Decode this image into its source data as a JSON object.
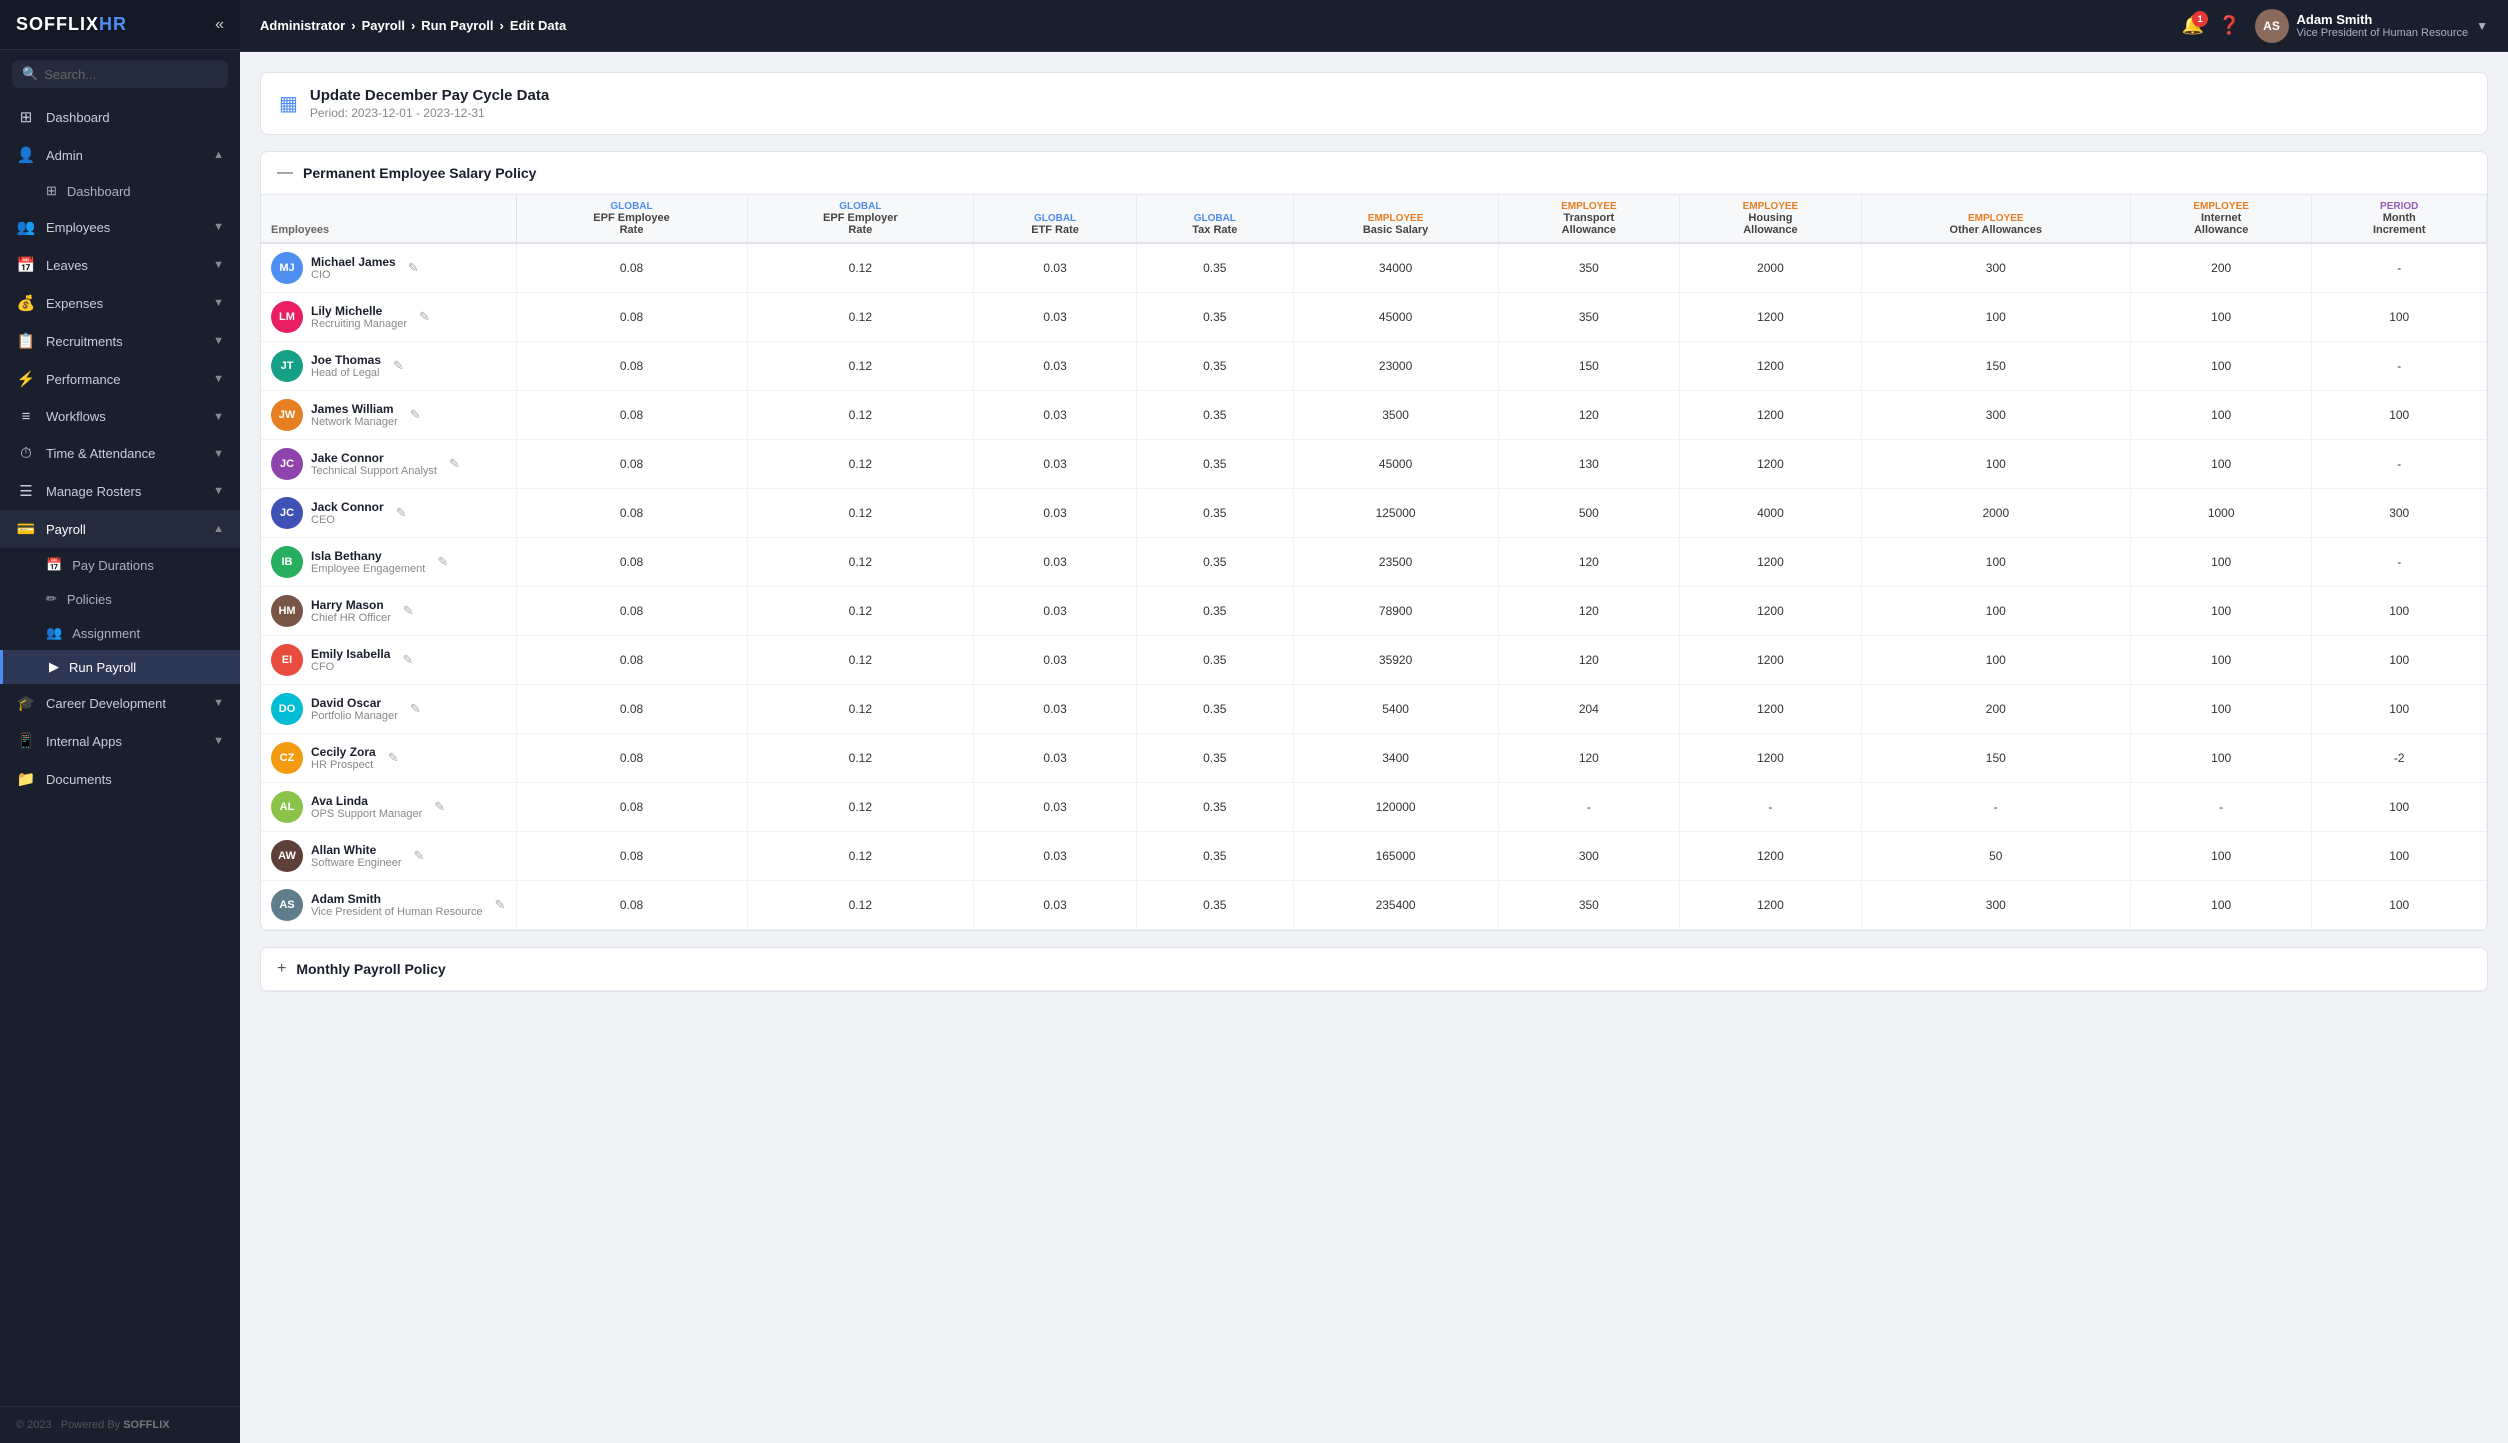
{
  "app": {
    "name": "SOFFLIX",
    "name_suffix": "HR",
    "logo_label": "SOFFLIXHR"
  },
  "sidebar": {
    "search_placeholder": "Search...",
    "items": [
      {
        "id": "dashboard",
        "label": "Dashboard",
        "icon": "⊞",
        "has_sub": false,
        "active": false
      },
      {
        "id": "admin",
        "label": "Admin",
        "icon": "👤",
        "has_sub": true,
        "active": false,
        "sub": [
          {
            "label": "Dashboard",
            "icon": "⊞"
          }
        ]
      },
      {
        "id": "employees",
        "label": "Employees",
        "icon": "👥",
        "has_sub": true,
        "active": false,
        "sub": []
      },
      {
        "id": "leaves",
        "label": "Leaves",
        "icon": "📅",
        "has_sub": true,
        "active": false,
        "sub": []
      },
      {
        "id": "expenses",
        "label": "Expenses",
        "icon": "💰",
        "has_sub": true,
        "active": false,
        "sub": []
      },
      {
        "id": "recruitments",
        "label": "Recruitments",
        "icon": "📋",
        "has_sub": true,
        "active": false,
        "sub": []
      },
      {
        "id": "performance",
        "label": "Performance",
        "icon": "⚡",
        "has_sub": true,
        "active": false,
        "sub": []
      },
      {
        "id": "workflows",
        "label": "Workflows",
        "icon": "≡",
        "has_sub": true,
        "active": false,
        "sub": []
      },
      {
        "id": "time-attendance",
        "label": "Time & Attendance",
        "icon": "⏱",
        "has_sub": true,
        "active": false,
        "sub": []
      },
      {
        "id": "manage-rosters",
        "label": "Manage Rosters",
        "icon": "☰",
        "has_sub": true,
        "active": false,
        "sub": []
      },
      {
        "id": "payroll",
        "label": "Payroll",
        "icon": "💳",
        "has_sub": true,
        "active": true,
        "sub": [
          {
            "label": "Pay Durations",
            "icon": "📅",
            "active": false
          },
          {
            "label": "Policies",
            "icon": "✏",
            "active": false
          },
          {
            "label": "Assignment",
            "icon": "👥",
            "active": false
          },
          {
            "label": "Run Payroll",
            "icon": "▶",
            "active": true
          }
        ]
      },
      {
        "id": "career-development",
        "label": "Career Development",
        "icon": "🎓",
        "has_sub": true,
        "active": false,
        "sub": []
      },
      {
        "id": "internal-apps",
        "label": "Internal Apps",
        "icon": "📱",
        "has_sub": true,
        "active": false,
        "sub": []
      },
      {
        "id": "documents",
        "label": "Documents",
        "icon": "📁",
        "has_sub": false,
        "active": false
      }
    ],
    "footer_year": "© 2023",
    "footer_powered": "Powered By",
    "footer_brand": "SOFFLIX"
  },
  "topbar": {
    "breadcrumb": [
      {
        "label": "Administrator",
        "active": false
      },
      {
        "label": "Payroll",
        "active": false
      },
      {
        "label": "Run Payroll",
        "active": false
      },
      {
        "label": "Edit Data",
        "active": true
      }
    ],
    "notification_count": "1",
    "user": {
      "name": "Adam Smith",
      "role": "Vice President of Human Resource",
      "initials": "AS"
    }
  },
  "page": {
    "title": "Update December Pay Cycle Data",
    "subtitle": "Period: 2023-12-01 - 2023-12-31"
  },
  "section1": {
    "title": "Permanent Employee Salary Policy",
    "columns": {
      "employees": "Employees",
      "global_epf_employee": {
        "group": "Global",
        "label": "EPF Employee Rate"
      },
      "global_epf_employer": {
        "group": "Global",
        "label": "EPF Employer Rate"
      },
      "global_etf": {
        "group": "Global",
        "label": "ETF Rate"
      },
      "global_tax": {
        "group": "Global",
        "label": "Tax Rate"
      },
      "emp_basic": {
        "group": "Employee",
        "label": "Basic Salary"
      },
      "emp_transport": {
        "group": "Employee",
        "label": "Transport Allowance"
      },
      "emp_housing": {
        "group": "Employee",
        "label": "Housing Allowance"
      },
      "emp_other": {
        "group": "Employee",
        "label": "Other Allowances"
      },
      "emp_internet": {
        "group": "Employee",
        "label": "Internet Allowance"
      },
      "period_month": {
        "group": "Period",
        "label": "Month Increment"
      }
    },
    "employees": [
      {
        "name": "Michael James",
        "title": "CIO",
        "initials": "MJ",
        "color": "av-blue",
        "epf_emp": "0.08",
        "epf_er": "0.12",
        "etf": "0.03",
        "tax": "0.35",
        "basic": "34000",
        "transport": "350",
        "housing": "2000",
        "other": "300",
        "internet": "200",
        "increment": "-"
      },
      {
        "name": "Lily Michelle",
        "title": "Recruiting Manager",
        "initials": "LM",
        "color": "av-pink",
        "epf_emp": "0.08",
        "epf_er": "0.12",
        "etf": "0.03",
        "tax": "0.35",
        "basic": "45000",
        "transport": "350",
        "housing": "1200",
        "other": "100",
        "internet": "100",
        "increment": "100"
      },
      {
        "name": "Joe Thomas",
        "title": "Head of Legal",
        "initials": "JT",
        "color": "av-teal",
        "epf_emp": "0.08",
        "epf_er": "0.12",
        "etf": "0.03",
        "tax": "0.35",
        "basic": "23000",
        "transport": "150",
        "housing": "1200",
        "other": "150",
        "internet": "100",
        "increment": "-"
      },
      {
        "name": "James William",
        "title": "Network Manager",
        "initials": "JW",
        "color": "av-orange",
        "epf_emp": "0.08",
        "epf_er": "0.12",
        "etf": "0.03",
        "tax": "0.35",
        "basic": "3500",
        "transport": "120",
        "housing": "1200",
        "other": "300",
        "internet": "100",
        "increment": "100"
      },
      {
        "name": "Jake Connor",
        "title": "Technical Support Analyst",
        "initials": "JC",
        "color": "av-purple",
        "epf_emp": "0.08",
        "epf_er": "0.12",
        "etf": "0.03",
        "tax": "0.35",
        "basic": "45000",
        "transport": "130",
        "housing": "1200",
        "other": "100",
        "internet": "100",
        "increment": "-"
      },
      {
        "name": "Jack Connor",
        "title": "CEO",
        "initials": "JC",
        "color": "av-indigo",
        "epf_emp": "0.08",
        "epf_er": "0.12",
        "etf": "0.03",
        "tax": "0.35",
        "basic": "125000",
        "transport": "500",
        "housing": "4000",
        "other": "2000",
        "internet": "1000",
        "increment": "300"
      },
      {
        "name": "Isla Bethany",
        "title": "Employee Engagement",
        "initials": "IB",
        "color": "av-green",
        "epf_emp": "0.08",
        "epf_er": "0.12",
        "etf": "0.03",
        "tax": "0.35",
        "basic": "23500",
        "transport": "120",
        "housing": "1200",
        "other": "100",
        "internet": "100",
        "increment": "-"
      },
      {
        "name": "Harry Mason",
        "title": "Chief HR Officer",
        "initials": "HM",
        "color": "av-brown",
        "epf_emp": "0.08",
        "epf_er": "0.12",
        "etf": "0.03",
        "tax": "0.35",
        "basic": "78900",
        "transport": "120",
        "housing": "1200",
        "other": "100",
        "internet": "100",
        "increment": "100"
      },
      {
        "name": "Emily Isabella",
        "title": "CFO",
        "initials": "EI",
        "color": "av-red",
        "epf_emp": "0.08",
        "epf_er": "0.12",
        "etf": "0.03",
        "tax": "0.35",
        "basic": "35920",
        "transport": "120",
        "housing": "1200",
        "other": "100",
        "internet": "100",
        "increment": "100"
      },
      {
        "name": "David Oscar",
        "title": "Portfolio Manager",
        "initials": "DO",
        "color": "av-cyan",
        "epf_emp": "0.08",
        "epf_er": "0.12",
        "etf": "0.03",
        "tax": "0.35",
        "basic": "5400",
        "transport": "204",
        "housing": "1200",
        "other": "200",
        "internet": "100",
        "increment": "100"
      },
      {
        "name": "Cecily Zora",
        "title": "HR Prospect",
        "initials": "CZ",
        "color": "av-amber",
        "epf_emp": "0.08",
        "epf_er": "0.12",
        "etf": "0.03",
        "tax": "0.35",
        "basic": "3400",
        "transport": "120",
        "housing": "1200",
        "other": "150",
        "internet": "100",
        "increment": "-2"
      },
      {
        "name": "Ava Linda",
        "title": "OPS Support Manager",
        "initials": "AL",
        "color": "av-lime",
        "epf_emp": "0.08",
        "epf_er": "0.12",
        "etf": "0.03",
        "tax": "0.35",
        "basic": "120000",
        "transport": "-",
        "housing": "-",
        "other": "-",
        "internet": "-",
        "increment": "100"
      },
      {
        "name": "Allan White",
        "title": "Software Engineer",
        "initials": "AW",
        "color": "av-deep",
        "epf_emp": "0.08",
        "epf_er": "0.12",
        "etf": "0.03",
        "tax": "0.35",
        "basic": "165000",
        "transport": "300",
        "housing": "1200",
        "other": "50",
        "internet": "100",
        "increment": "100"
      },
      {
        "name": "Adam Smith",
        "title": "Vice President of Human Resource",
        "initials": "AS",
        "color": "av-gray",
        "epf_emp": "0.08",
        "epf_er": "0.12",
        "etf": "0.03",
        "tax": "0.35",
        "basic": "235400",
        "transport": "350",
        "housing": "1200",
        "other": "300",
        "internet": "100",
        "increment": "100"
      }
    ]
  },
  "section2": {
    "title": "Monthly Payroll Policy"
  }
}
